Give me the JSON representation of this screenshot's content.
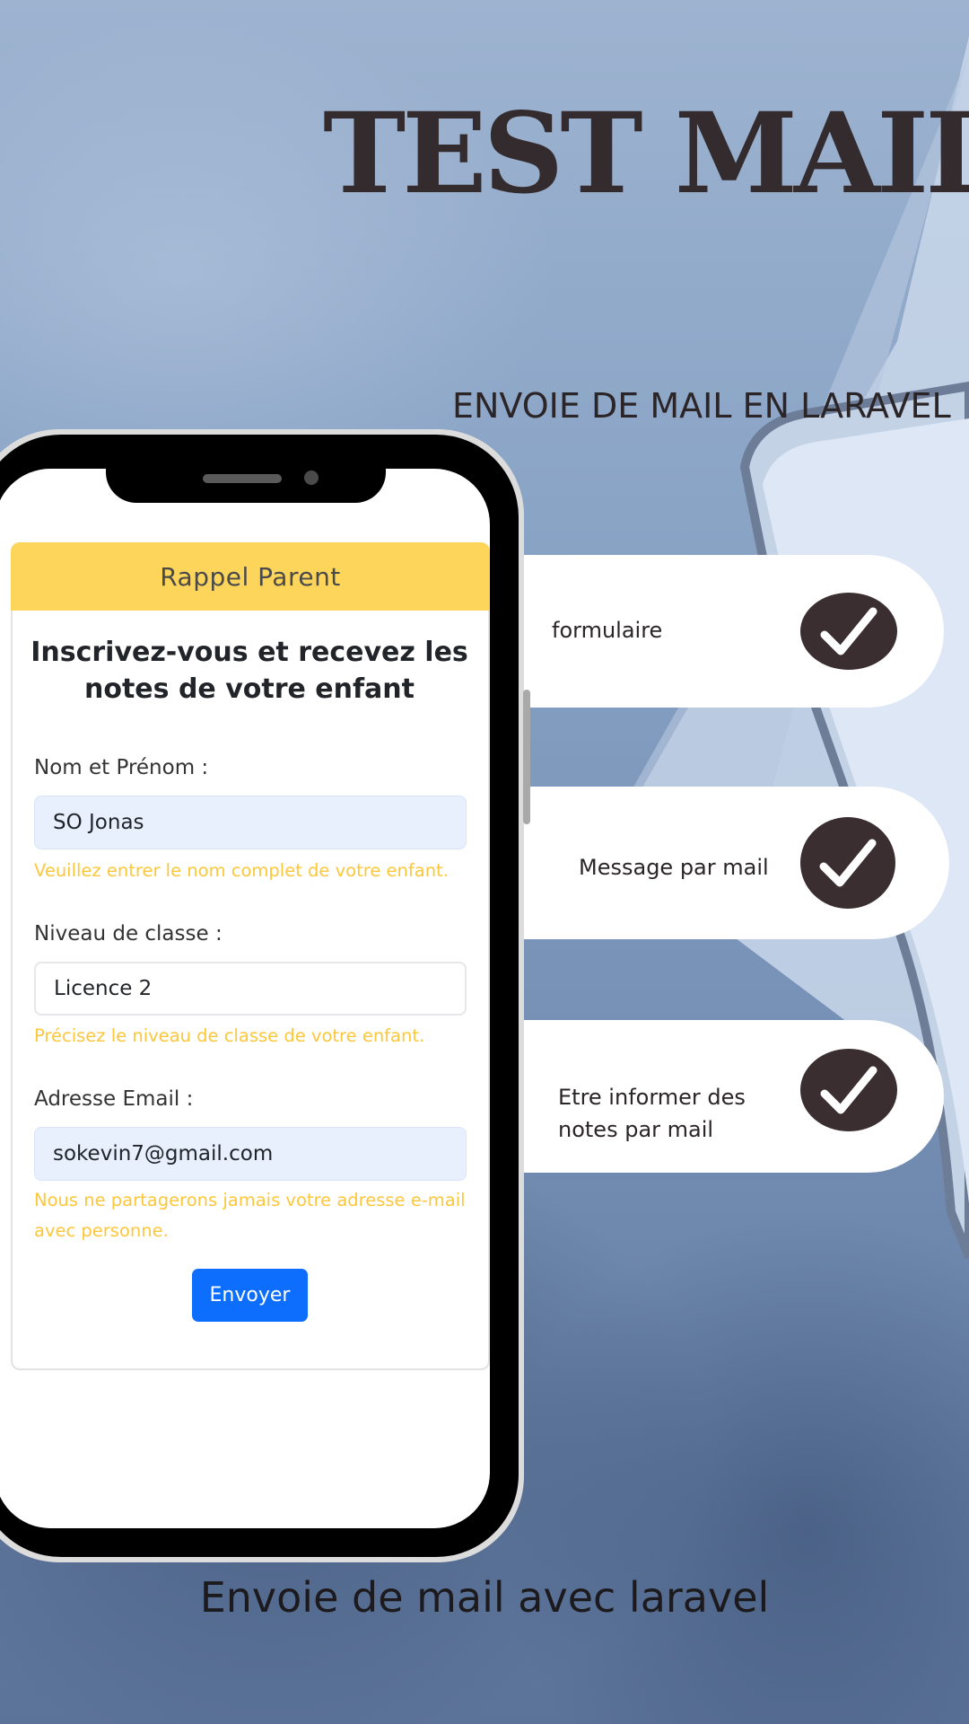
{
  "poster": {
    "title": "TEST MAIL",
    "subtitle": "ENVOIE DE MAIL EN LARAVEL",
    "bottom_caption": "Envoie de mail avec laravel"
  },
  "form": {
    "header": "Rappel Parent",
    "heading": "Inscrivez-vous et recevez les notes de votre enfant",
    "name_label": "Nom et Prénom :",
    "name_value": "SO Jonas",
    "name_help": "Veuillez entrer le nom complet de votre enfant.",
    "class_label": "Niveau de classe :",
    "class_value": "Licence 2",
    "class_help": "Précisez le niveau de classe de votre enfant.",
    "email_label": "Adresse Email :",
    "email_value": "sokevin7@gmail.com",
    "email_help": "Nous ne partagerons jamais votre adresse e-mail avec personne.",
    "submit_label": "Envoyer"
  },
  "features": [
    {
      "label": "formulaire",
      "icon": "check-icon"
    },
    {
      "label": "Message par mail",
      "icon": "check-icon"
    },
    {
      "label": "Etre informer des notes par mail",
      "icon": "check-icon"
    }
  ],
  "colors": {
    "header_yellow": "#fed55b",
    "help_yellow": "#fdc73b",
    "button_blue": "#0d6efd",
    "check_dark": "#3a2e31"
  }
}
